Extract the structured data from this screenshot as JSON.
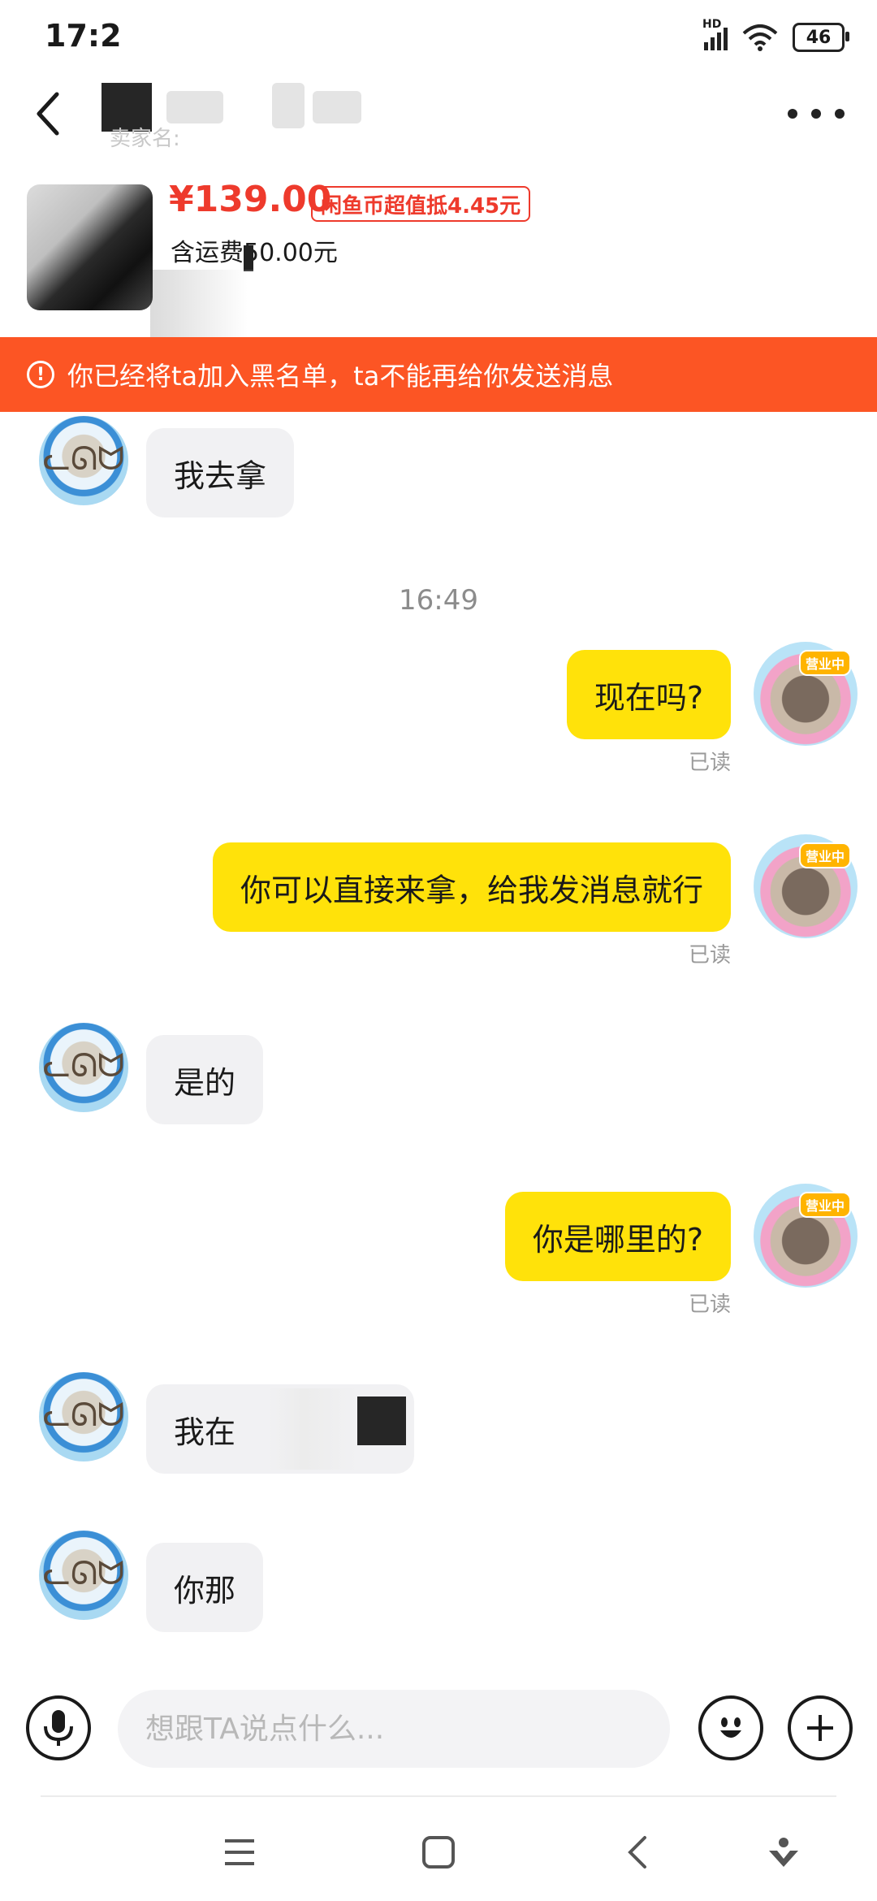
{
  "status_bar": {
    "time": "17:2",
    "network": "HD",
    "battery": "46"
  },
  "header": {
    "seller_caption": "卖家名:"
  },
  "product": {
    "price": "¥139.00",
    "coin_badge": "闲鱼币超值抵4.45元",
    "shipping_prefix": "含运费5",
    "shipping_suffix": "0.00元"
  },
  "banner": {
    "icon": "!",
    "text": "你已经将ta加入黑名单，ta不能再给你发送消息"
  },
  "messages": [
    {
      "side": "left",
      "text": "我去拿"
    },
    {
      "type": "timestamp",
      "text": "16:49"
    },
    {
      "side": "right",
      "text": "现在吗?",
      "status": "已读",
      "avatar_tag": "营业中"
    },
    {
      "side": "right",
      "text": "你可以直接来拿，给我发消息就行",
      "status": "已读",
      "avatar_tag": "营业中"
    },
    {
      "side": "left",
      "text": "是的"
    },
    {
      "side": "right",
      "text": "你是哪里的?",
      "status": "已读",
      "avatar_tag": "营业中"
    },
    {
      "side": "left",
      "text": "我在"
    },
    {
      "side": "left",
      "text": "你那"
    }
  ],
  "input": {
    "placeholder": "想跟TA说点什么..."
  },
  "icons": {
    "back": "chevron-left-icon",
    "more": "more-dots-icon",
    "mic": "microphone-icon",
    "emoji": "emoji-icon",
    "plus": "plus-icon",
    "nav_menu": "menu-icon",
    "nav_home": "home-square-icon",
    "nav_back": "back-icon",
    "nav_assist": "assistant-icon"
  },
  "colors": {
    "price": "#ee3a2c",
    "banner": "#fc5524",
    "my_bubble": "#ffe20a",
    "their_bubble": "#f1f1f3"
  }
}
